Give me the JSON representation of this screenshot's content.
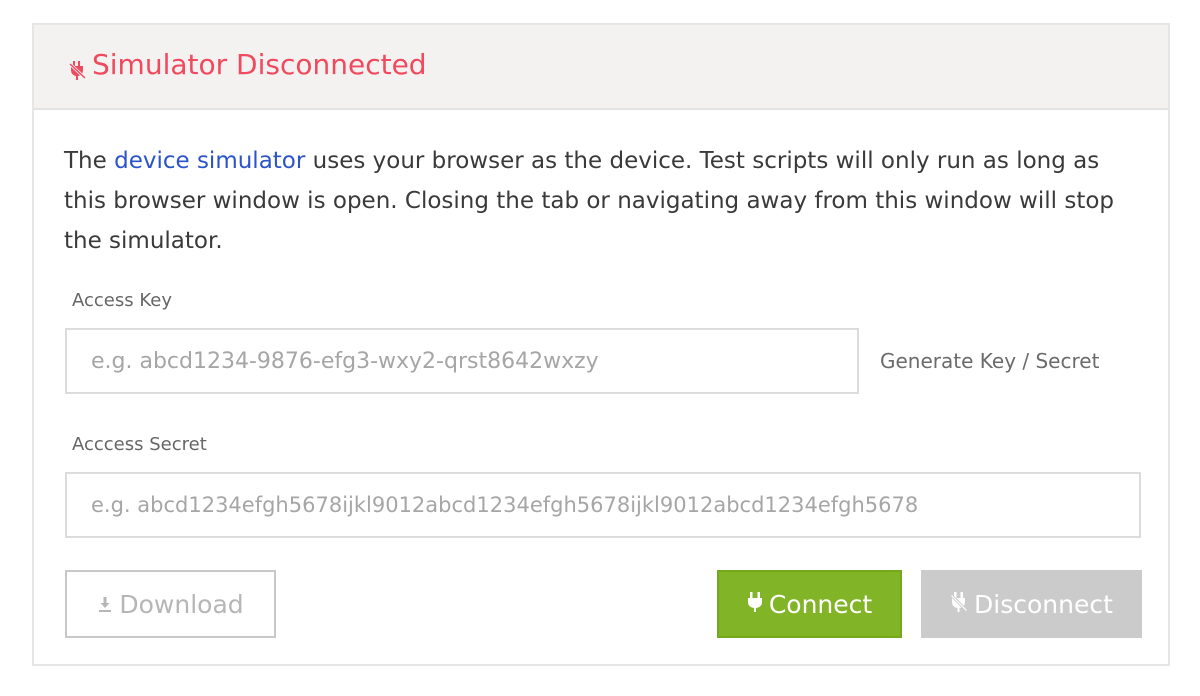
{
  "header": {
    "title": "Simulator Disconnected",
    "icon": "unplugged-icon",
    "color": "#f04a5e"
  },
  "description": {
    "before_link": "The ",
    "link_text": "device simulator",
    "after_link": " uses your browser as the device. Test scripts will only run as long as this browser window is open. Closing the tab or navigating away from this window will stop the simulator."
  },
  "access_key": {
    "label": "Access Key",
    "value": "",
    "placeholder": "e.g. abcd1234-9876-efg3-wxy2-qrst8642wxzy"
  },
  "generate_link": "Generate Key / Secret",
  "access_secret": {
    "label": "Acccess Secret",
    "value": "",
    "placeholder": "e.g. abcd1234efgh5678ijkl9012abcd1234efgh5678ijkl9012abcd1234efgh5678"
  },
  "buttons": {
    "download": {
      "label": "Download",
      "icon": "download-icon",
      "enabled": false
    },
    "connect": {
      "label": "Connect",
      "icon": "plug-icon",
      "color": "#82b427"
    },
    "disconnect": {
      "label": "Disconnect",
      "icon": "unplugged-icon",
      "enabled": false
    }
  }
}
